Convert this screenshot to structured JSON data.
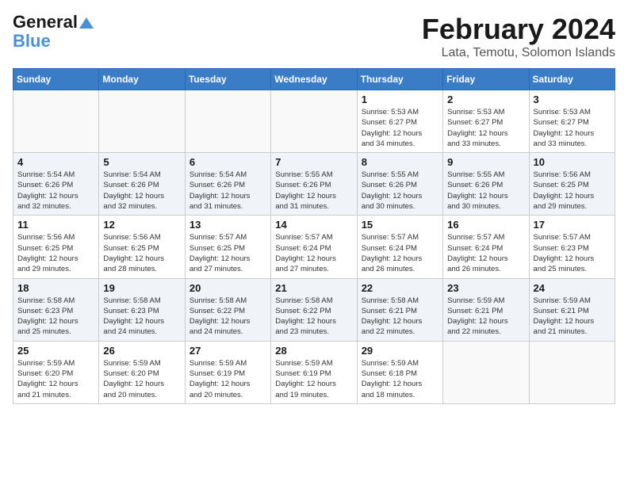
{
  "header": {
    "logo_line1": "General",
    "logo_line2": "Blue",
    "month_year": "February 2024",
    "location": "Lata, Temotu, Solomon Islands"
  },
  "weekdays": [
    "Sunday",
    "Monday",
    "Tuesday",
    "Wednesday",
    "Thursday",
    "Friday",
    "Saturday"
  ],
  "weeks": [
    [
      {
        "day": "",
        "info": ""
      },
      {
        "day": "",
        "info": ""
      },
      {
        "day": "",
        "info": ""
      },
      {
        "day": "",
        "info": ""
      },
      {
        "day": "1",
        "info": "Sunrise: 5:53 AM\nSunset: 6:27 PM\nDaylight: 12 hours\nand 34 minutes."
      },
      {
        "day": "2",
        "info": "Sunrise: 5:53 AM\nSunset: 6:27 PM\nDaylight: 12 hours\nand 33 minutes."
      },
      {
        "day": "3",
        "info": "Sunrise: 5:53 AM\nSunset: 6:27 PM\nDaylight: 12 hours\nand 33 minutes."
      }
    ],
    [
      {
        "day": "4",
        "info": "Sunrise: 5:54 AM\nSunset: 6:26 PM\nDaylight: 12 hours\nand 32 minutes."
      },
      {
        "day": "5",
        "info": "Sunrise: 5:54 AM\nSunset: 6:26 PM\nDaylight: 12 hours\nand 32 minutes."
      },
      {
        "day": "6",
        "info": "Sunrise: 5:54 AM\nSunset: 6:26 PM\nDaylight: 12 hours\nand 31 minutes."
      },
      {
        "day": "7",
        "info": "Sunrise: 5:55 AM\nSunset: 6:26 PM\nDaylight: 12 hours\nand 31 minutes."
      },
      {
        "day": "8",
        "info": "Sunrise: 5:55 AM\nSunset: 6:26 PM\nDaylight: 12 hours\nand 30 minutes."
      },
      {
        "day": "9",
        "info": "Sunrise: 5:55 AM\nSunset: 6:26 PM\nDaylight: 12 hours\nand 30 minutes."
      },
      {
        "day": "10",
        "info": "Sunrise: 5:56 AM\nSunset: 6:25 PM\nDaylight: 12 hours\nand 29 minutes."
      }
    ],
    [
      {
        "day": "11",
        "info": "Sunrise: 5:56 AM\nSunset: 6:25 PM\nDaylight: 12 hours\nand 29 minutes."
      },
      {
        "day": "12",
        "info": "Sunrise: 5:56 AM\nSunset: 6:25 PM\nDaylight: 12 hours\nand 28 minutes."
      },
      {
        "day": "13",
        "info": "Sunrise: 5:57 AM\nSunset: 6:25 PM\nDaylight: 12 hours\nand 27 minutes."
      },
      {
        "day": "14",
        "info": "Sunrise: 5:57 AM\nSunset: 6:24 PM\nDaylight: 12 hours\nand 27 minutes."
      },
      {
        "day": "15",
        "info": "Sunrise: 5:57 AM\nSunset: 6:24 PM\nDaylight: 12 hours\nand 26 minutes."
      },
      {
        "day": "16",
        "info": "Sunrise: 5:57 AM\nSunset: 6:24 PM\nDaylight: 12 hours\nand 26 minutes."
      },
      {
        "day": "17",
        "info": "Sunrise: 5:57 AM\nSunset: 6:23 PM\nDaylight: 12 hours\nand 25 minutes."
      }
    ],
    [
      {
        "day": "18",
        "info": "Sunrise: 5:58 AM\nSunset: 6:23 PM\nDaylight: 12 hours\nand 25 minutes."
      },
      {
        "day": "19",
        "info": "Sunrise: 5:58 AM\nSunset: 6:23 PM\nDaylight: 12 hours\nand 24 minutes."
      },
      {
        "day": "20",
        "info": "Sunrise: 5:58 AM\nSunset: 6:22 PM\nDaylight: 12 hours\nand 24 minutes."
      },
      {
        "day": "21",
        "info": "Sunrise: 5:58 AM\nSunset: 6:22 PM\nDaylight: 12 hours\nand 23 minutes."
      },
      {
        "day": "22",
        "info": "Sunrise: 5:58 AM\nSunset: 6:21 PM\nDaylight: 12 hours\nand 22 minutes."
      },
      {
        "day": "23",
        "info": "Sunrise: 5:59 AM\nSunset: 6:21 PM\nDaylight: 12 hours\nand 22 minutes."
      },
      {
        "day": "24",
        "info": "Sunrise: 5:59 AM\nSunset: 6:21 PM\nDaylight: 12 hours\nand 21 minutes."
      }
    ],
    [
      {
        "day": "25",
        "info": "Sunrise: 5:59 AM\nSunset: 6:20 PM\nDaylight: 12 hours\nand 21 minutes."
      },
      {
        "day": "26",
        "info": "Sunrise: 5:59 AM\nSunset: 6:20 PM\nDaylight: 12 hours\nand 20 minutes."
      },
      {
        "day": "27",
        "info": "Sunrise: 5:59 AM\nSunset: 6:19 PM\nDaylight: 12 hours\nand 20 minutes."
      },
      {
        "day": "28",
        "info": "Sunrise: 5:59 AM\nSunset: 6:19 PM\nDaylight: 12 hours\nand 19 minutes."
      },
      {
        "day": "29",
        "info": "Sunrise: 5:59 AM\nSunset: 6:18 PM\nDaylight: 12 hours\nand 18 minutes."
      },
      {
        "day": "",
        "info": ""
      },
      {
        "day": "",
        "info": ""
      }
    ]
  ]
}
